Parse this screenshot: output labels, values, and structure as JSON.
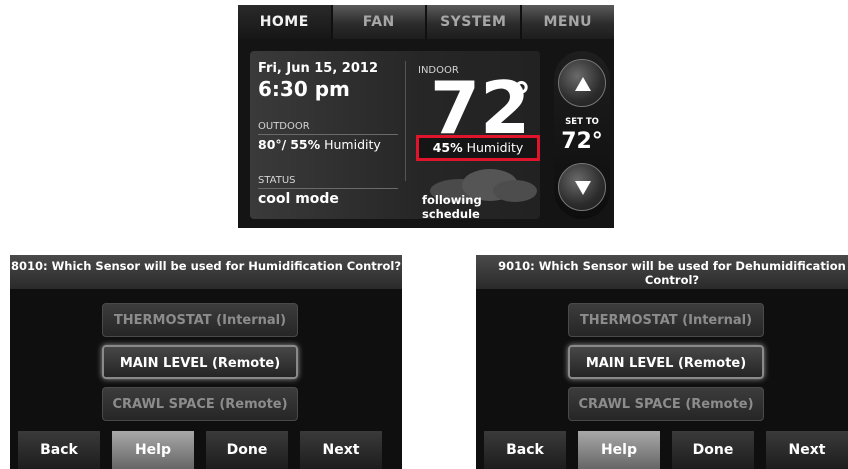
{
  "thermostat": {
    "tabs": [
      "HOME",
      "FAN",
      "SYSTEM",
      "MENU"
    ],
    "date": "Fri, Jun 15, 2012",
    "time": "6:30 pm",
    "outdoor_label": "OUTDOOR",
    "outdoor_temp": "80°/",
    "outdoor_humidity_value": "55%",
    "outdoor_humidity_text": "Humidity",
    "status_label": "STATUS",
    "status_value": "cool mode",
    "indoor_label": "INDOOR",
    "indoor_temp": "72",
    "indoor_degree": "°",
    "indoor_humidity_value": "45%",
    "indoor_humidity_text": "Humidity",
    "schedule": "following schedule",
    "set_to_label": "SET TO",
    "set_to_value": "72°",
    "highlight_color": "#e0142a"
  },
  "setup_left": {
    "title": "8010: Which Sensor will be used for Humidification Control?",
    "options": [
      {
        "label": "THERMOSTAT (Internal)",
        "state": "disabled"
      },
      {
        "label": "MAIN LEVEL (Remote)",
        "state": "selected"
      },
      {
        "label": "CRAWL SPACE (Remote)",
        "state": "disabled"
      }
    ],
    "buttons": [
      "Back",
      "Help",
      "Done",
      "Next"
    ]
  },
  "setup_right": {
    "title": "9010: Which Sensor will be used for Dehumidification Control?",
    "options": [
      {
        "label": "THERMOSTAT (Internal)",
        "state": "disabled"
      },
      {
        "label": "MAIN LEVEL (Remote)",
        "state": "selected"
      },
      {
        "label": "CRAWL SPACE (Remote)",
        "state": "disabled"
      }
    ],
    "buttons": [
      "Back",
      "Help",
      "Done",
      "Next"
    ]
  }
}
